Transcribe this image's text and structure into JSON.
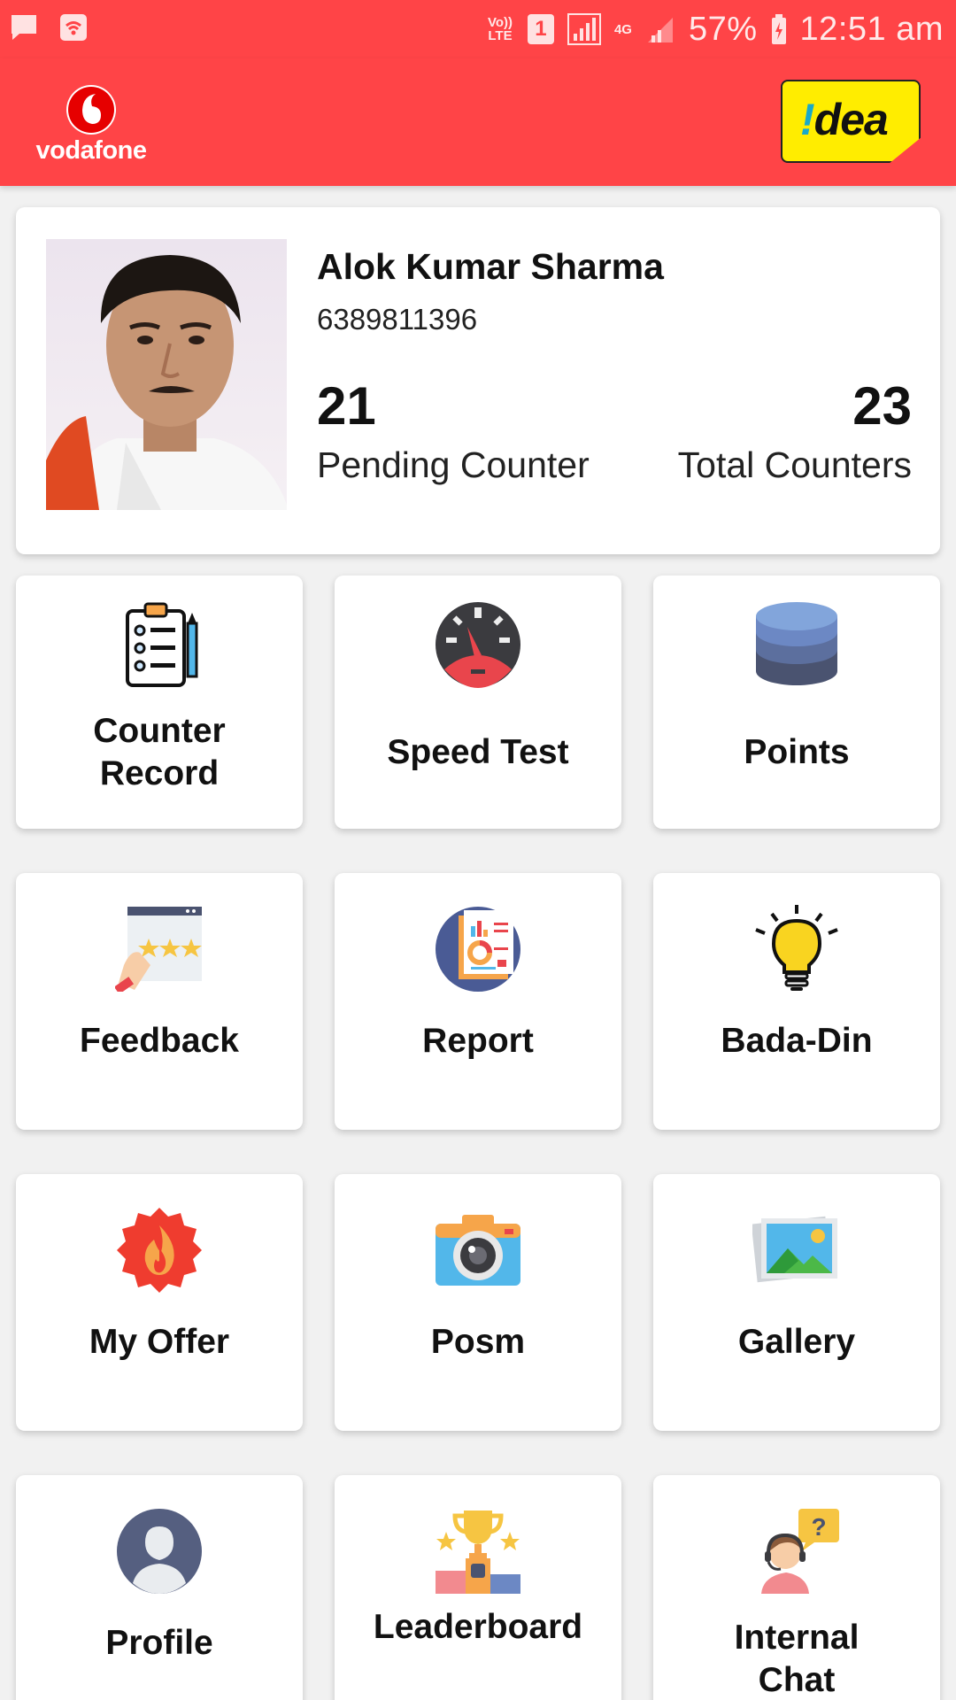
{
  "status_bar": {
    "network_label": "Vo)) LTE",
    "sim": "1",
    "net_type": "4G",
    "battery": "57%",
    "time": "12:51 am"
  },
  "header": {
    "left_brand": "vodafone",
    "right_brand_bang": "!",
    "right_brand_rest": "dea"
  },
  "profile": {
    "name": "Alok Kumar Sharma",
    "phone": "6389811396",
    "pending_count": "21",
    "pending_label": "Pending Counter",
    "total_count": "23",
    "total_label": "Total Counters"
  },
  "tiles": [
    {
      "label": "Counter Record",
      "icon": "clipboard-icon"
    },
    {
      "label": "Speed Test",
      "icon": "speedometer-icon"
    },
    {
      "label": "Points",
      "icon": "database-stack-icon"
    },
    {
      "label": "Feedback",
      "icon": "rating-stars-icon"
    },
    {
      "label": "Report",
      "icon": "report-chart-icon"
    },
    {
      "label": "Bada-Din",
      "icon": "lightbulb-icon"
    },
    {
      "label": "My Offer",
      "icon": "offer-badge-icon"
    },
    {
      "label": "Posm",
      "icon": "camera-icon"
    },
    {
      "label": "Gallery",
      "icon": "gallery-photos-icon"
    },
    {
      "label": "Profile",
      "icon": "user-avatar-icon"
    },
    {
      "label": "Leaderboard",
      "icon": "trophy-podium-icon"
    },
    {
      "label": "Internal Chat",
      "icon": "chat-agent-icon"
    }
  ],
  "colors": {
    "brand_red": "#ff4447",
    "idea_yellow": "#ffed00"
  }
}
